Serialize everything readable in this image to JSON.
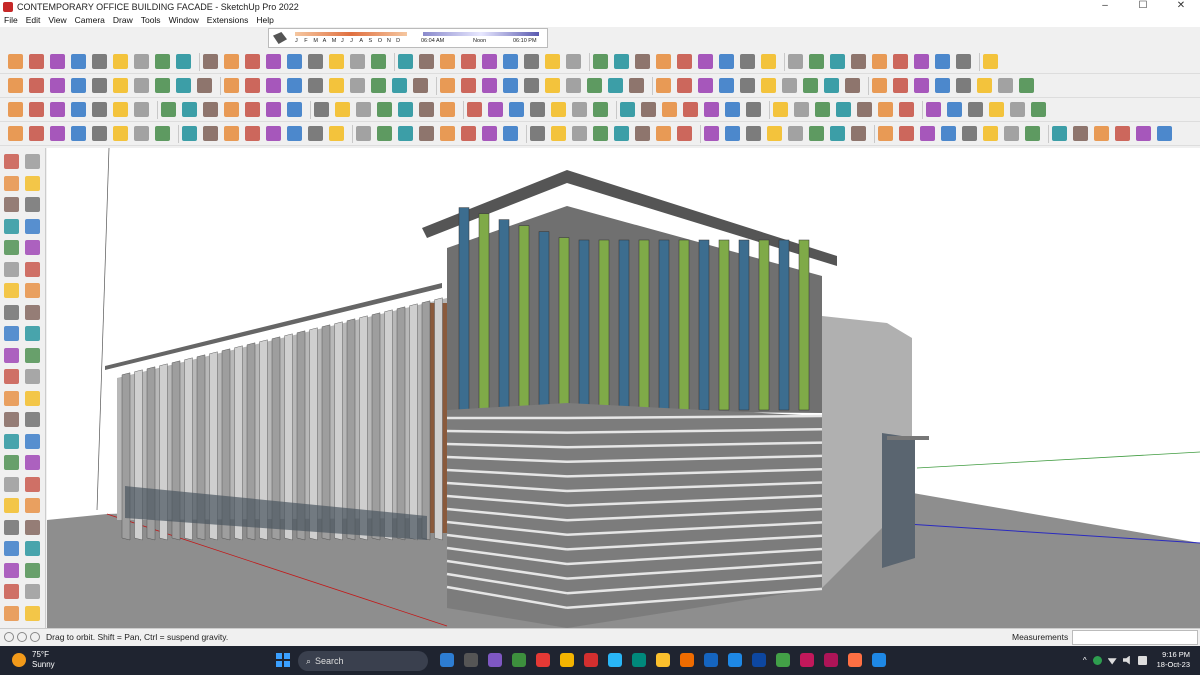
{
  "window": {
    "title": "CONTEMPORARY OFFICE BUILDING FACADE - SketchUp Pro 2022",
    "controls": [
      "–",
      "☐",
      "✕"
    ]
  },
  "menu": [
    "File",
    "Edit",
    "View",
    "Camera",
    "Draw",
    "Tools",
    "Window",
    "Extensions",
    "Help"
  ],
  "shadows": {
    "months": [
      "J",
      "F",
      "M",
      "A",
      "M",
      "J",
      "J",
      "A",
      "S",
      "O",
      "N",
      "D"
    ],
    "time_start": "06:04 AM",
    "time_noon": "Noon",
    "time_end": "06:10 PM"
  },
  "status": {
    "hint": "Drag to orbit.  Shift = Pan, Ctrl = suspend gravity.",
    "measurements_label": "Measurements",
    "measurements_value": ""
  },
  "taskbar": {
    "temp": "75°F",
    "condition": "Sunny",
    "search_placeholder": "Search",
    "time": "9:16 PM",
    "date": "18-Oct-23"
  },
  "colors": {
    "accent_glass": "#3c6d8f",
    "accent_green": "#7faa48",
    "taskbar_bg": "#1f2430"
  }
}
